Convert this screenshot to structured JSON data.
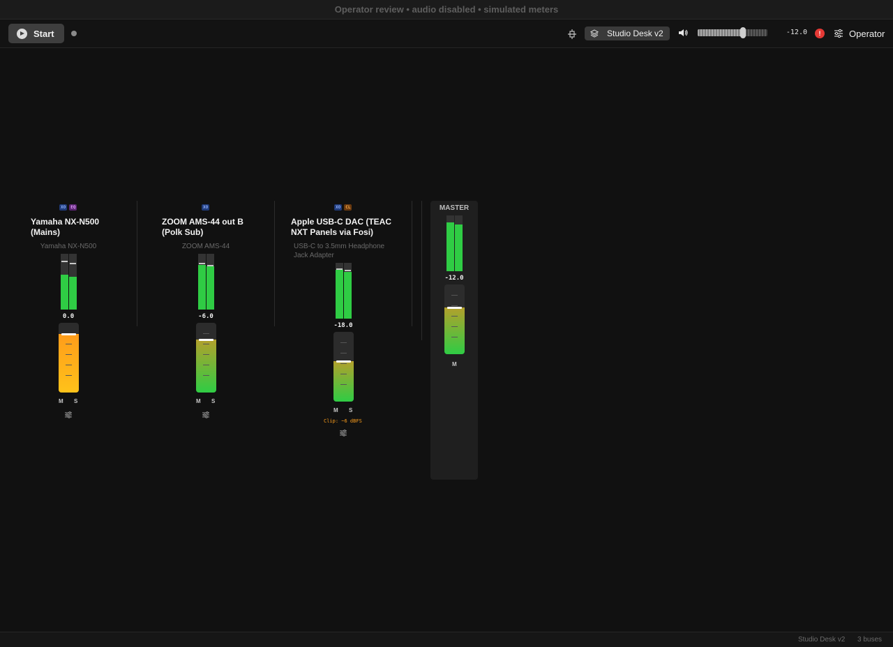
{
  "window": {
    "title": "Operator review • audio disabled • simulated meters"
  },
  "toolbar": {
    "start_label": "Start",
    "preset_name": "Studio Desk v2",
    "master_volume_value": "-12.0",
    "master_volume_fraction": 0.65,
    "alert_glyph": "!",
    "operator_label": "Operator",
    "icons": [
      "play-icon",
      "split-icon",
      "layers-icon",
      "speaker-icon",
      "alert-icon",
      "sliders-icon"
    ]
  },
  "strips": [
    {
      "badges": [
        "XO",
        "EQ"
      ],
      "name": "Yamaha NX-N500 (Mains)",
      "device": "Yamaha NX-N500",
      "gain_db": "0.0",
      "meter_levels": [
        0.62,
        0.59
      ],
      "meter_peaks": [
        0.85,
        0.81
      ],
      "fader_fraction": 0.84,
      "fader_color": "amber",
      "mute_label": "M",
      "solo_label": "S"
    },
    {
      "badges": [
        "XO"
      ],
      "name": "ZOOM AMS-44 out B (Polk Sub)",
      "device": "ZOOM AMS-44",
      "gain_db": "-6.0",
      "meter_levels": [
        0.8,
        0.77
      ],
      "meter_peaks": [
        0.81,
        0.78
      ],
      "fader_fraction": 0.76,
      "fader_color": "green",
      "mute_label": "M",
      "solo_label": "S"
    },
    {
      "badges": [
        "XO",
        "CL"
      ],
      "name": "Apple USB-C DAC (TEAC NXT Panels via Fosi)",
      "device": "USB-C to 3.5mm Headphone Jack Adapter",
      "gain_db": "-18.0",
      "meter_levels": [
        0.87,
        0.84
      ],
      "meter_peaks": [
        0.88,
        0.85
      ],
      "fader_fraction": 0.58,
      "fader_color": "green",
      "mute_label": "M",
      "solo_label": "S",
      "clip_note": "Clip: ~6 dBFS"
    }
  ],
  "master": {
    "title": "MASTER",
    "gain_db": "-12.0",
    "meter_levels": [
      0.87,
      0.84
    ],
    "fader_fraction": 0.67,
    "mute_label": "M"
  },
  "footer": {
    "preset": "Studio Desk v2",
    "bus_count": "3 buses"
  },
  "colors": {
    "background": "#111111",
    "meter_green": "#2fcc44",
    "alert_red": "#e53935",
    "clip_orange": "#ff9f1c",
    "badge_xo": "#1f3a78",
    "badge_eq": "#5a2470",
    "badge_cl": "#6b3a0f"
  }
}
